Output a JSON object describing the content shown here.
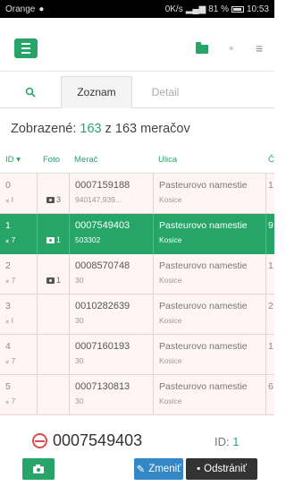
{
  "status_bar": {
    "carrier": "Orange",
    "net_speed": "0K/s",
    "battery": "81 %",
    "time": "10:53"
  },
  "header": {
    "menu_icon": "hamburger-icon",
    "icons": [
      "folder-icon",
      "rss-icon",
      "list-icon"
    ]
  },
  "tabs": {
    "search_icon": "search-icon",
    "list": "Zoznam",
    "detail": "Detail"
  },
  "summary": {
    "label": "Zobrazené:",
    "shown": "163",
    "of": "z 163 meračov"
  },
  "table": {
    "columns": [
      "ID ▾",
      "Foto",
      "Merač",
      "Ulica",
      "Č"
    ],
    "rows": [
      {
        "id": "0",
        "sub": "⁎ I",
        "foto": "3",
        "merac": "0007159188",
        "merac_sub": "940147,939...",
        "ulica": "Pasteurovo namestie",
        "mesto": "Kosice",
        "extra": "1"
      },
      {
        "id": "1",
        "sub": "⁎ 7",
        "foto": "1",
        "merac": "0007549403",
        "merac_sub": "503302",
        "ulica": "Pasteurovo namestie",
        "mesto": "Kosice",
        "extra": "9"
      },
      {
        "id": "2",
        "sub": "⁎ 7",
        "foto": "1",
        "merac": "0008570748",
        "merac_sub": "30",
        "ulica": "Pasteurovo namestie",
        "mesto": "Kosice",
        "extra": "1"
      },
      {
        "id": "3",
        "sub": "⁎ I",
        "foto": "",
        "merac": "0010282639",
        "merac_sub": "30",
        "ulica": "Pasteurovo namestie",
        "mesto": "Kosice",
        "extra": "2"
      },
      {
        "id": "4",
        "sub": "⁎ 7",
        "foto": "",
        "merac": "0007160193",
        "merac_sub": "30",
        "ulica": "Pasteurovo namestie",
        "mesto": "Kosice",
        "extra": "1"
      },
      {
        "id": "5",
        "sub": "⁎ 7",
        "foto": "",
        "merac": "0007130813",
        "merac_sub": "30",
        "ulica": "Pasteurovo namestie",
        "mesto": "Kosice",
        "extra": "6"
      }
    ],
    "selected_index": 1
  },
  "footer": {
    "meter": "0007549403",
    "id_label": "ID:",
    "id_value": "1",
    "edit": "Zmeniť",
    "delete": "Odstrániť",
    "colors": {
      "green": "#27a468",
      "blue": "#3387c7",
      "dark": "#333333",
      "red": "#e04a4a"
    }
  }
}
